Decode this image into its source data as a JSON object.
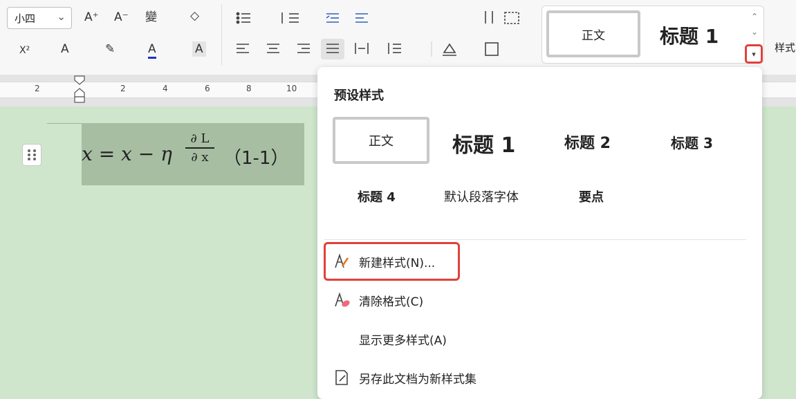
{
  "toolbar": {
    "font_size": "小四",
    "grow_font": "A⁺",
    "shrink_font": "A⁻",
    "phonetic": "變",
    "clear": "◇",
    "superscript": "X²",
    "effects": "A",
    "highlight": "✎",
    "font_color": "A",
    "char_shading": "A"
  },
  "style_gallery": {
    "normal_label": "正文",
    "heading1_label": "标题 1",
    "styles_label": "样式"
  },
  "ruler": {
    "ticks": [
      "2",
      "2",
      "4",
      "6",
      "8",
      "10"
    ]
  },
  "document": {
    "equation_lhs": "x = x − η",
    "frac_num": "∂ L",
    "frac_den": "∂ x",
    "equation_number": "（1-1）"
  },
  "dropdown": {
    "title": "预设样式",
    "presets": {
      "normal": "正文",
      "h1": "标题 1",
      "h2": "标题 2",
      "h3": "标题 3",
      "h4": "标题 4",
      "default_font": "默认段落字体",
      "key_point": "要点"
    },
    "items": {
      "new_style": "新建样式(N)...",
      "clear_format": "清除格式(C)",
      "show_more": "显示更多样式(A)",
      "save_as_set": "另存此文档为新样式集"
    }
  }
}
